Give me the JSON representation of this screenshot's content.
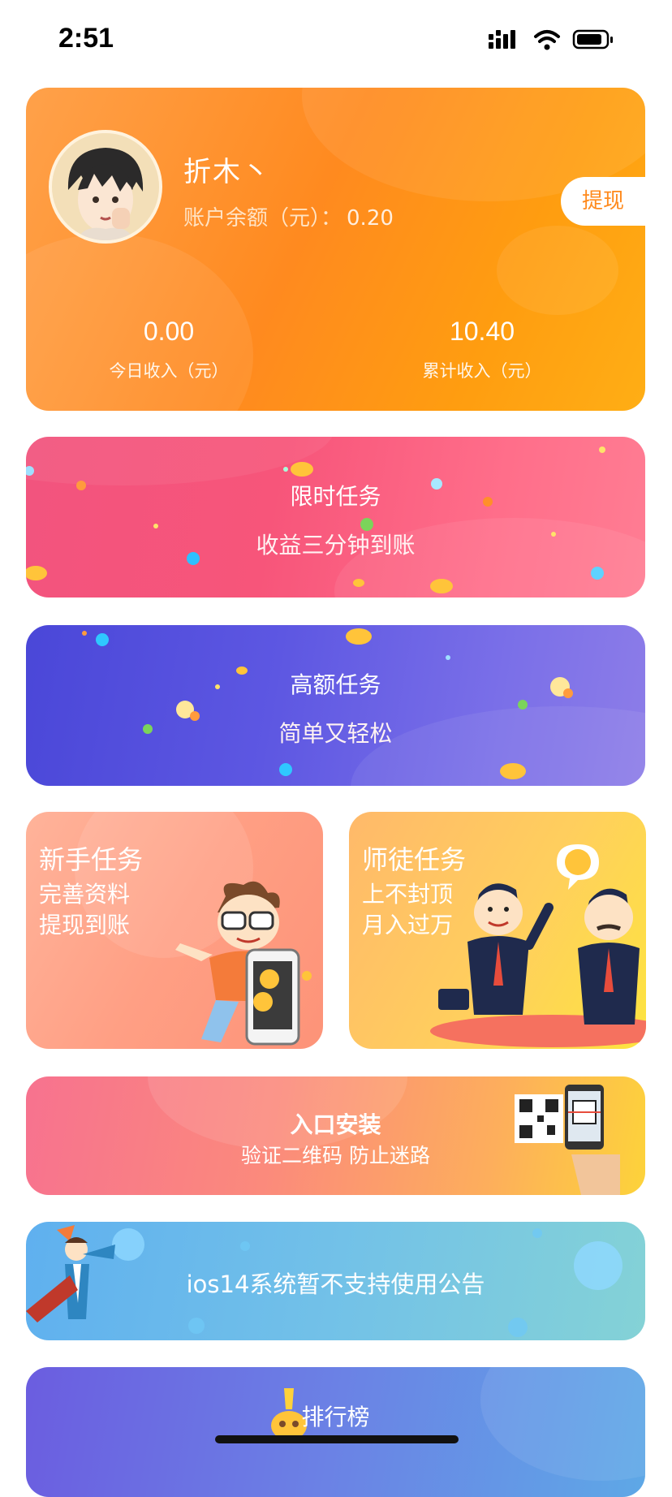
{
  "status_bar": {
    "time": "2:51"
  },
  "profile": {
    "username": "折木丶",
    "balance_label": "账户余额（元）：",
    "balance_value": "0.20",
    "withdraw_label": "提现",
    "today_income_value": "0.00",
    "today_income_label": "今日收入（元）",
    "total_income_value": "10.40",
    "total_income_label": "累计收入（元）"
  },
  "limited_task": {
    "title": "限时任务",
    "subtitle": "收益三分钟到账"
  },
  "high_task": {
    "title": "高额任务",
    "subtitle": "简单又轻松"
  },
  "newbie_task": {
    "title": "新手任务",
    "line1": "完善资料",
    "line2": "提现到账"
  },
  "mentor_task": {
    "title": "师徒任务",
    "line1": "上不封顶",
    "line2": "月入过万"
  },
  "entry_install": {
    "title": "入口安装",
    "subtitle": "验证二维码 防止迷路"
  },
  "notice": {
    "text": "ios14系统暂不支持使用公告"
  },
  "ranking": {
    "title": "排行榜"
  },
  "colors": {
    "profile_orange": "#ff8a1f",
    "limited_pink": "#f7557a",
    "high_purple": "#5d57e2",
    "newbie_peach": "#ff9f84",
    "mentor_yellow": "#ffcf5d",
    "notice_blue": "#72c1e8",
    "ranking_indigo": "#6b82e5"
  }
}
